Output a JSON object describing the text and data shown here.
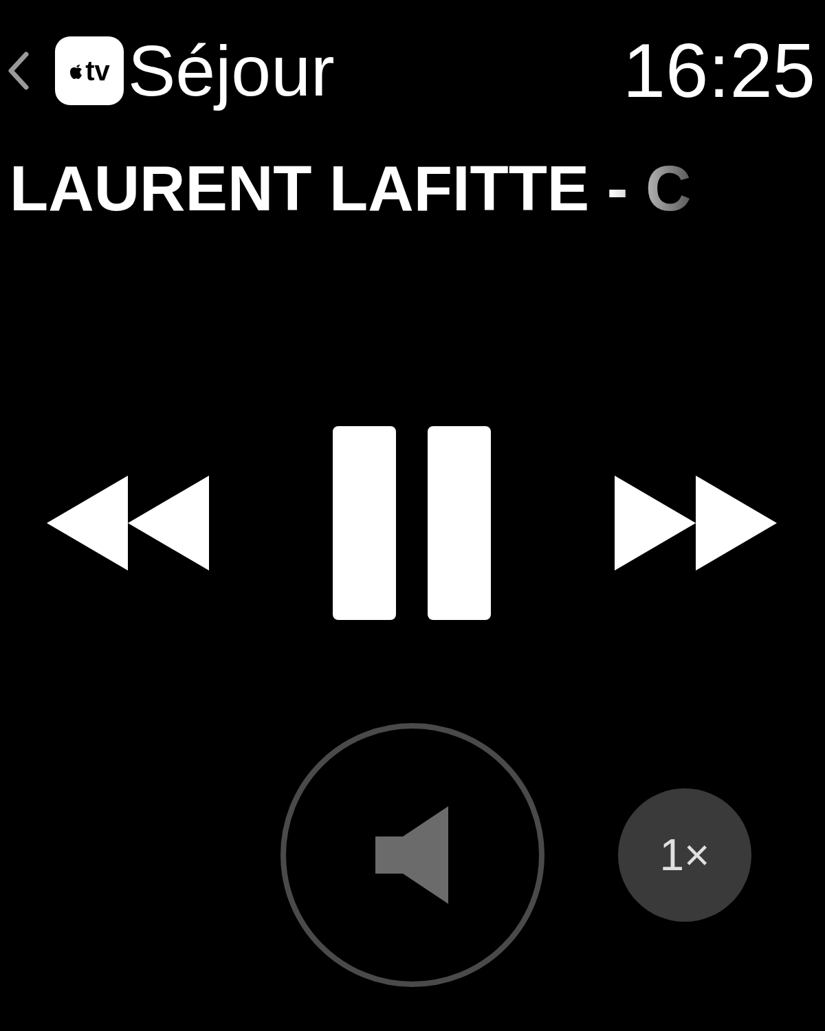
{
  "header": {
    "app_badge": "tv",
    "title": "Séjour",
    "time": "16:25"
  },
  "now_playing": {
    "title": "LAURENT LAFITTE - C"
  },
  "controls": {
    "playing": true
  },
  "rate": {
    "label": "1×"
  }
}
